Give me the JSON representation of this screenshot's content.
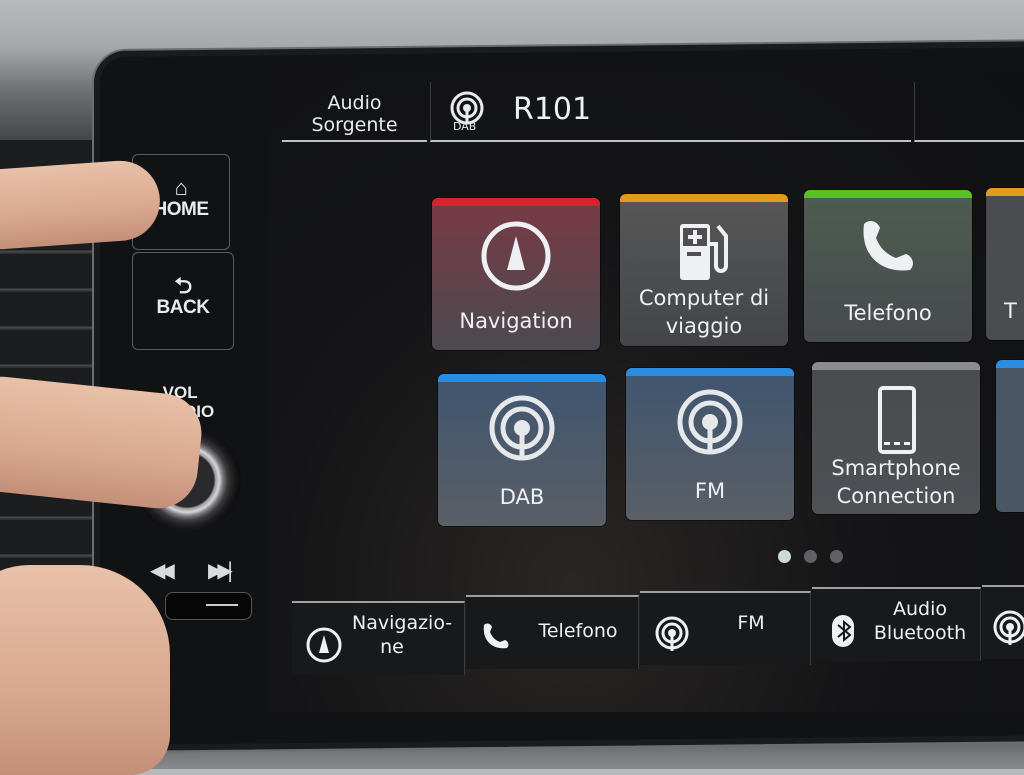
{
  "hardware": {
    "home": {
      "label": "HOME",
      "icon": "home-icon"
    },
    "back": {
      "label": "BACK",
      "icon": "back-arrow-icon"
    },
    "volume": {
      "line1": "VOL",
      "line2": "AUDIO",
      "icon": "power-icon"
    },
    "prev": {
      "glyph": "◀◀",
      "icon": "skip-back-icon"
    },
    "next": {
      "glyph": "▶▶|",
      "icon": "skip-forward-icon"
    }
  },
  "topbar": {
    "source_line1": "Audio",
    "source_line2": "Sorgente",
    "station_type": "DAB",
    "station_name": "R101"
  },
  "tiles": [
    {
      "label": "Navigation",
      "icon": "navigation-compass-icon",
      "accent": "#d8232f",
      "bg": "#5c3a40"
    },
    {
      "label": "Computer di viaggio",
      "icon": "fuel-pump-icon",
      "accent": "#e49a1c",
      "bg": "#4d4c4b"
    },
    {
      "label": "Telefono",
      "icon": "phone-icon",
      "accent": "#5bbf22",
      "bg": "#4a564d"
    },
    {
      "label": "T",
      "icon": "partial-icon",
      "accent": "#e49a1c",
      "bg": "#4a4c50"
    },
    {
      "label": "DAB",
      "icon": "radio-broadcast-icon",
      "accent": "#2a8de0",
      "bg": "#4f5866"
    },
    {
      "label": "FM",
      "icon": "radio-broadcast-icon",
      "accent": "#2a8de0",
      "bg": "#4e5766"
    },
    {
      "label": "Smartphone Connection",
      "icon": "smartphone-icon",
      "accent": "#8a8c8f",
      "bg": "#4a4b4e"
    },
    {
      "label": "",
      "icon": "partial-icon",
      "accent": "#2a8de0",
      "bg": "#4b5665"
    }
  ],
  "pagination": {
    "current": 1,
    "total": 3
  },
  "shortcuts": [
    {
      "label": "Navigazio- ne",
      "icon": "navigation-compass-icon"
    },
    {
      "label": "Telefono",
      "icon": "phone-icon"
    },
    {
      "label": "FM",
      "icon": "radio-broadcast-icon"
    },
    {
      "label": "Audio Bluetooth",
      "icon": "bluetooth-icon"
    },
    {
      "label": "",
      "icon": "radio-broadcast-icon"
    }
  ]
}
